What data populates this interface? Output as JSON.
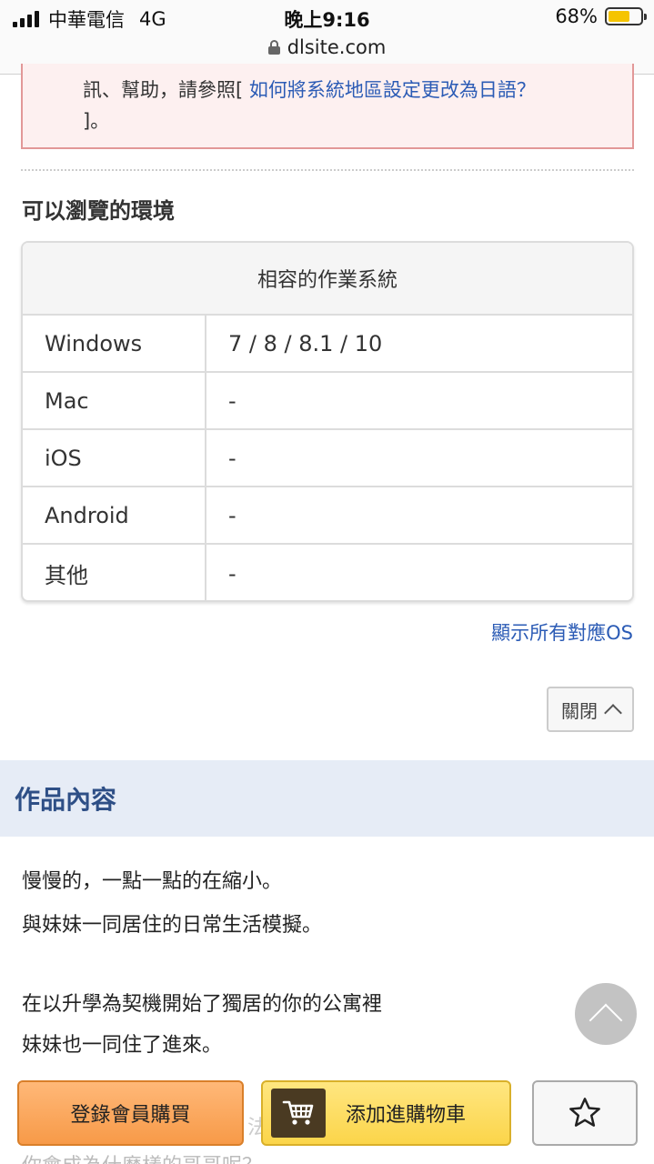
{
  "status_bar": {
    "carrier": "中華電信",
    "network": "4G",
    "time": "晚上9:16",
    "battery_percent": "68%",
    "battery_level": 0.68,
    "url": "dlsite.com"
  },
  "notice": {
    "text_prefix": "訊、幫助，請參照[",
    "link_text": "如何將系統地區設定更改為日語？",
    "text_suffix": "]。"
  },
  "environment": {
    "heading": "可以瀏覽的環境",
    "table_header": "相容的作業系統",
    "rows": [
      {
        "os": "Windows",
        "value": "7 / 8 / 8.1 / 10"
      },
      {
        "os": "Mac",
        "value": "-"
      },
      {
        "os": "iOS",
        "value": "-"
      },
      {
        "os": "Android",
        "value": "-"
      },
      {
        "os": "其他",
        "value": "-"
      }
    ],
    "show_all_link": "顯示所有對應OS",
    "close_button": "關閉"
  },
  "works": {
    "title": "作品內容",
    "lines": [
      "慢慢的，一點一點的在縮小。",
      "與妹妹一同居住的日常生活模擬。",
      "在以升學為契機開始了獨居的你的公寓裡",
      "妹妹也一同住了進來。"
    ],
    "partial_behind_buttons": "法",
    "partial_cut_line": "你會成為什麼樣的哥哥呢？"
  },
  "actions": {
    "member_buy": "登錄會員購買",
    "add_to_cart": "添加進購物車"
  },
  "colors": {
    "link": "#2b5bb5",
    "notice_border": "#e29898",
    "notice_bg": "#fdf0f0",
    "works_band_bg": "#e6ecf6",
    "works_title": "#2e4f86",
    "member_button": "#f79a48",
    "cart_button": "#fbd54a",
    "battery": "#f5c400"
  },
  "icons": {
    "lock": "lock-icon",
    "cart": "cart-icon",
    "favorite": "star-outline-icon",
    "scroll_top": "chevron-up-icon",
    "close_chevron": "chevron-up-icon"
  }
}
